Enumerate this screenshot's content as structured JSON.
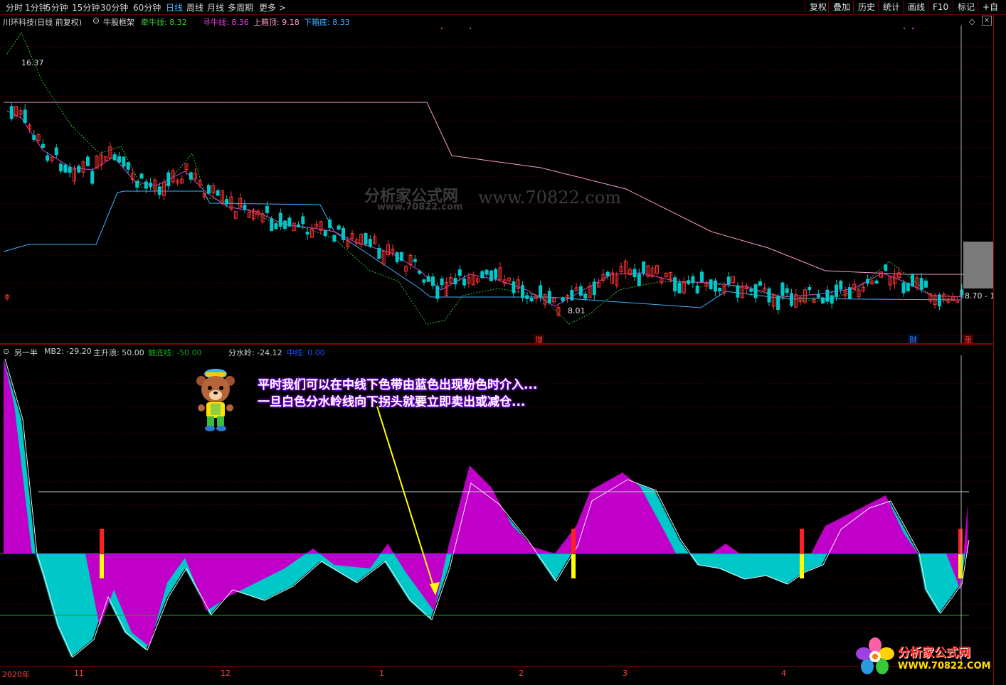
{
  "toolbar": {
    "periods": [
      "分时",
      "1分钟",
      "5分钟",
      "15分钟",
      "30分钟",
      "60分钟",
      "日线",
      "周线",
      "月线",
      "多周期",
      "更多 >"
    ],
    "active_period": "日线",
    "tools": [
      "复权",
      "叠加",
      "历史",
      "统计",
      "画线",
      "F10",
      "标记",
      "+自"
    ]
  },
  "main_panel": {
    "stock_title": "川环科技(日线 前复权)",
    "indicator_name": "牛股框架",
    "indicators": [
      {
        "label": "牵牛线: 8.32",
        "color": "#38c838"
      },
      {
        "label": "寻牛线: 8.36",
        "color": "#e040e0"
      },
      {
        "label": "上箱顶: 9.18",
        "color": "#ff9ad0"
      },
      {
        "label": "下箱底: 8.33",
        "color": "#40b0ff"
      }
    ],
    "high_marker": "16.37",
    "low_marker": "8.01",
    "right_price": "8.70 - 1",
    "event_tags": [
      {
        "text": "增",
        "color": "#ff4040"
      },
      {
        "text": "财",
        "color": "#4080ff"
      },
      {
        "text": "涨",
        "color": "#ff4040"
      }
    ],
    "watermark": {
      "cn": "分析家公式网",
      "url1": "www.70822.com",
      "url2": "www.70822.com"
    }
  },
  "sub_panel": {
    "indicator_name": "另一半",
    "values": [
      {
        "label": "MB2: -29.20",
        "color": "#d0d0d0"
      },
      {
        "label": "主升浪: 50.00",
        "color": "#d0d0d0"
      },
      {
        "label": "触底线: -50.00",
        "color": "#20a020"
      },
      {
        "label": "分水岭: -24.12",
        "color": "#d0d0d0"
      },
      {
        "label": "中线: 0.00",
        "color": "#2050ff"
      }
    ],
    "annotation_lines": [
      "平时我们可以在中线下色带由蓝色出现粉色时介入...",
      "一旦白色分水岭线向下拐头就要立即卖出或减仓..."
    ]
  },
  "time_axis": {
    "labels": [
      "2020年",
      "11",
      "12",
      "1",
      "2",
      "3",
      "4"
    ]
  },
  "logo": {
    "name": "分析家公式网",
    "url": "WWW.70822.COM"
  },
  "colors": {
    "up": "#ff3232",
    "down": "#00c8c8",
    "pink": "#c000c8",
    "cyan": "#00c8c8",
    "border": "#8b0000",
    "box_top": "#ff9ad0",
    "box_bottom": "#40b0ff"
  }
}
